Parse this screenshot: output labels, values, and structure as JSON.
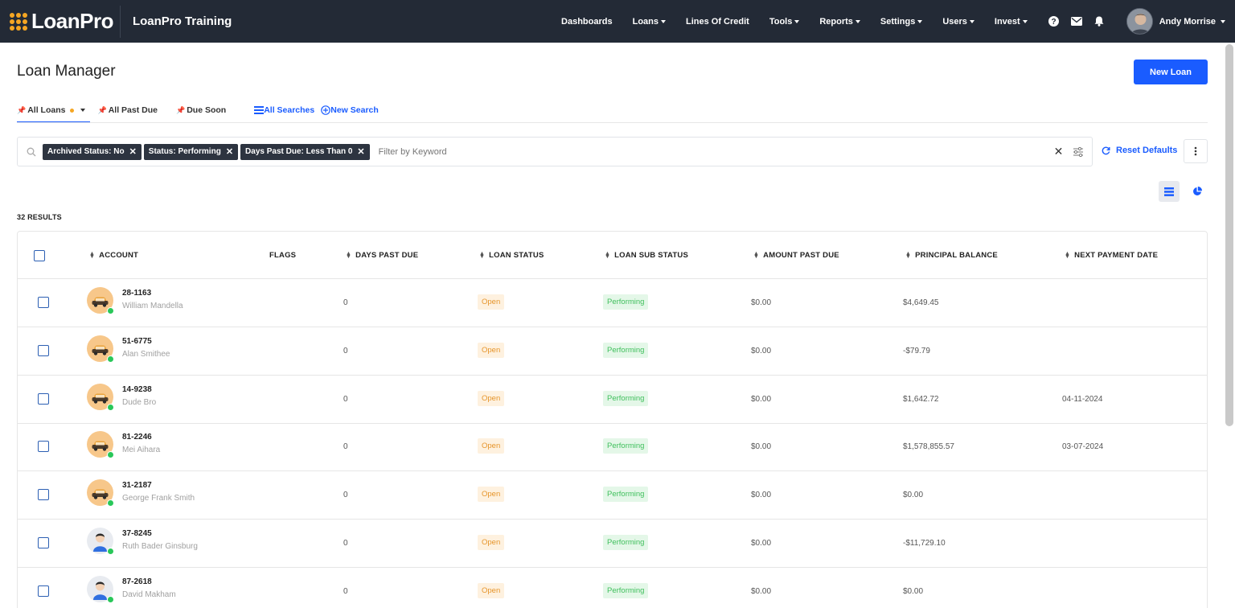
{
  "brand": {
    "logo_text": "LoanPro",
    "app_title": "LoanPro Training",
    "accent": "#f5a623",
    "primary": "#1a5cff"
  },
  "nav": {
    "items": [
      "Dashboards",
      "Loans",
      "Lines Of Credit",
      "Tools",
      "Reports",
      "Settings",
      "Users",
      "Invest"
    ],
    "dropdown": [
      false,
      true,
      false,
      true,
      true,
      true,
      true,
      true
    ],
    "icons": [
      "help-icon",
      "mail-icon",
      "bell-icon"
    ],
    "user_name": "Andy Morrise"
  },
  "page": {
    "title": "Loan Manager",
    "new_loan_label": "New Loan",
    "results": "32 RESULTS"
  },
  "tabs": {
    "all_loans": "All Loans",
    "all_past_due": "All Past Due",
    "due_soon": "Due Soon",
    "all_searches": "All Searches",
    "new_search": "New Search"
  },
  "filters": {
    "chips": [
      "Archived Status: No",
      "Status: Performing",
      "Days Past Due: Less Than 0"
    ],
    "placeholder": "Filter by Keyword",
    "reset_label": "Reset Defaults"
  },
  "table": {
    "headers": {
      "account": "ACCOUNT",
      "flags": "FLAGS",
      "days_past_due": "DAYS PAST DUE",
      "loan_status": "LOAN STATUS",
      "loan_sub_status": "LOAN SUB STATUS",
      "amount_past_due": "AMOUNT PAST DUE",
      "principal_balance": "PRINCIPAL BALANCE",
      "next_payment_date": "NEXT PAYMENT DATE"
    },
    "rows": [
      {
        "account": "28-1163",
        "name": "William Mandella",
        "avatar": "car",
        "days": "0",
        "status": "Open",
        "sub_status": "Performing",
        "amount": "$0.00",
        "principal": "$4,649.45",
        "next_date": ""
      },
      {
        "account": "51-6775",
        "name": "Alan Smithee",
        "avatar": "car",
        "days": "0",
        "status": "Open",
        "sub_status": "Performing",
        "amount": "$0.00",
        "principal": "-$79.79",
        "next_date": ""
      },
      {
        "account": "14-9238",
        "name": "Dude Bro",
        "avatar": "car",
        "days": "0",
        "status": "Open",
        "sub_status": "Performing",
        "amount": "$0.00",
        "principal": "$1,642.72",
        "next_date": "04-11-2024"
      },
      {
        "account": "81-2246",
        "name": "Mei Aihara",
        "avatar": "car",
        "days": "0",
        "status": "Open",
        "sub_status": "Performing",
        "amount": "$0.00",
        "principal": "$1,578,855.57",
        "next_date": "03-07-2024"
      },
      {
        "account": "31-2187",
        "name": "George Frank Smith",
        "avatar": "car",
        "days": "0",
        "status": "Open",
        "sub_status": "Performing",
        "amount": "$0.00",
        "principal": "$0.00",
        "next_date": ""
      },
      {
        "account": "37-8245",
        "name": "Ruth Bader Ginsburg",
        "avatar": "person",
        "days": "0",
        "status": "Open",
        "sub_status": "Performing",
        "amount": "$0.00",
        "principal": "-$11,729.10",
        "next_date": ""
      },
      {
        "account": "87-2618",
        "name": "David Makham",
        "avatar": "person",
        "days": "0",
        "status": "Open",
        "sub_status": "Performing",
        "amount": "$0.00",
        "principal": "$0.00",
        "next_date": ""
      }
    ]
  }
}
